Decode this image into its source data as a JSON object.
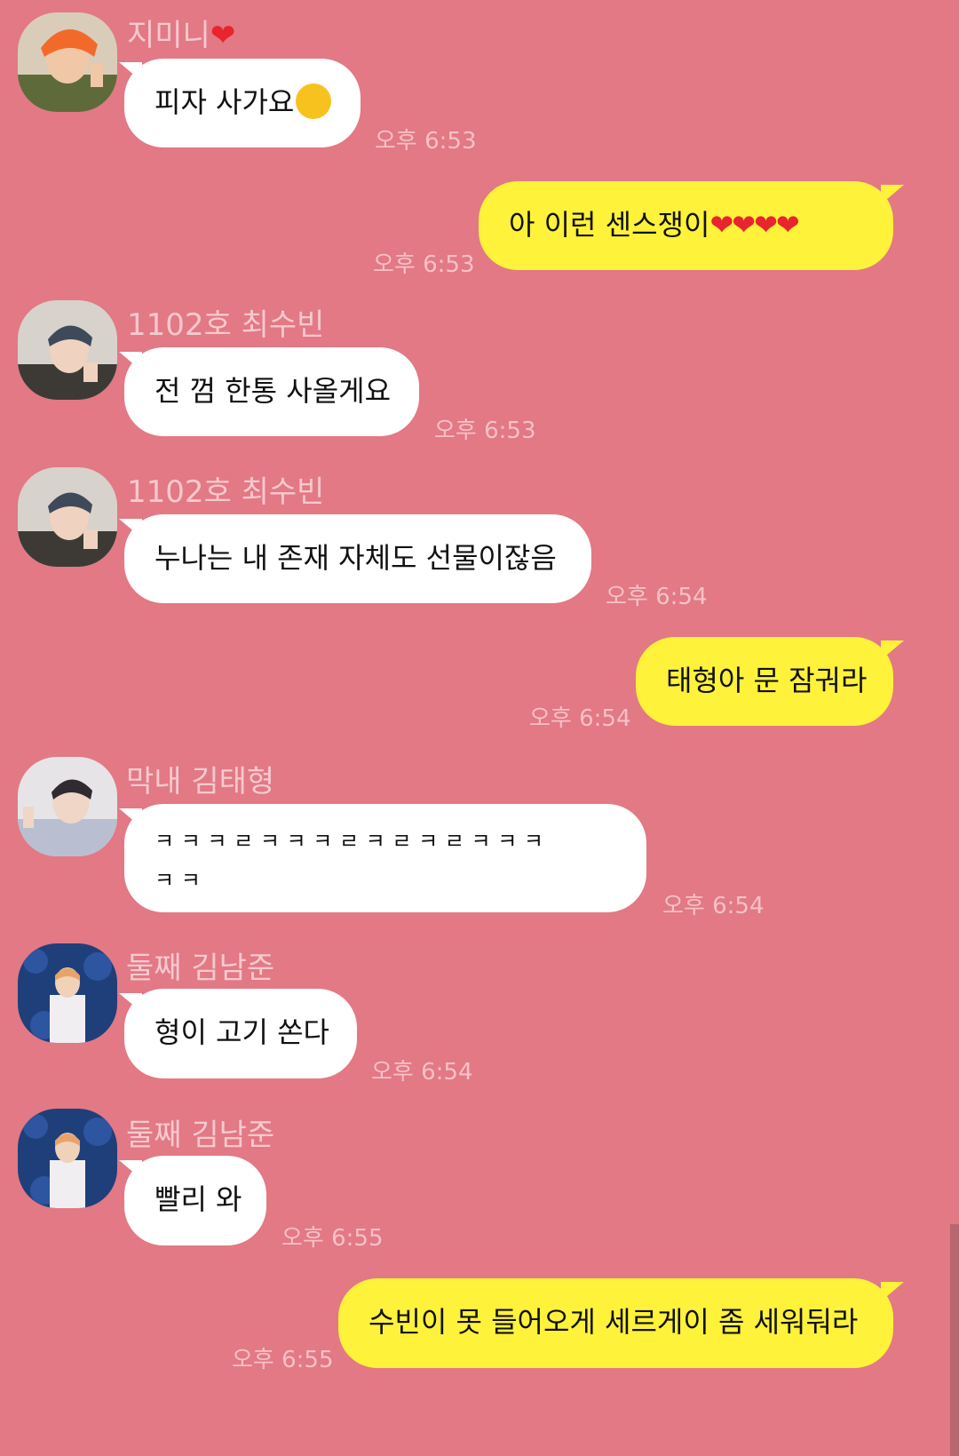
{
  "messages": [
    {
      "sender": "지미니",
      "text": "피자 사가요",
      "time": "오후 6:53"
    },
    {
      "text": "아 이런 센스쟁이",
      "hearts": "❤❤❤❤",
      "time": "오후 6:53"
    },
    {
      "sender": "1102호 최수빈",
      "text": "전 껌 한통 사올게요",
      "time": "오후 6:53"
    },
    {
      "sender": "1102호 최수빈",
      "text": "누나는 내 존재 자체도 선물이잖음",
      "time": "오후 6:54"
    },
    {
      "text": "태형아 문 잠궈라",
      "time": "오후 6:54"
    },
    {
      "sender": "막내 김태형",
      "text_line1": "ㅋ ㅋ ㅋ ㄹ ㅋ ㅋ ㅋ ㄹ ㅋ ㄹ ㅋ ㄹ ㅋ ㅋ ㅋ",
      "text_line2": "ㅋ ㅋ",
      "time": "오후 6:54"
    },
    {
      "sender": "둘째 김남준",
      "text": "형이 고기 쏜다",
      "time": "오후 6:54"
    },
    {
      "sender": "둘째 김남준",
      "text": "빨리 와",
      "time": "오후 6:55"
    },
    {
      "text": "수빈이 못 들어오게 세르게이 좀 세워둬라",
      "time": "오후 6:55"
    }
  ],
  "icons": {
    "sender_heart": "heart-icon",
    "pizza_emoji": "grinning-squinting-face-emoji"
  },
  "colors": {
    "background": "#e27985",
    "incoming_bubble": "#ffffff",
    "outgoing_bubble": "#fff23a",
    "sender_name": "#f6c9cf",
    "timestamp": "#f5c1c7"
  }
}
